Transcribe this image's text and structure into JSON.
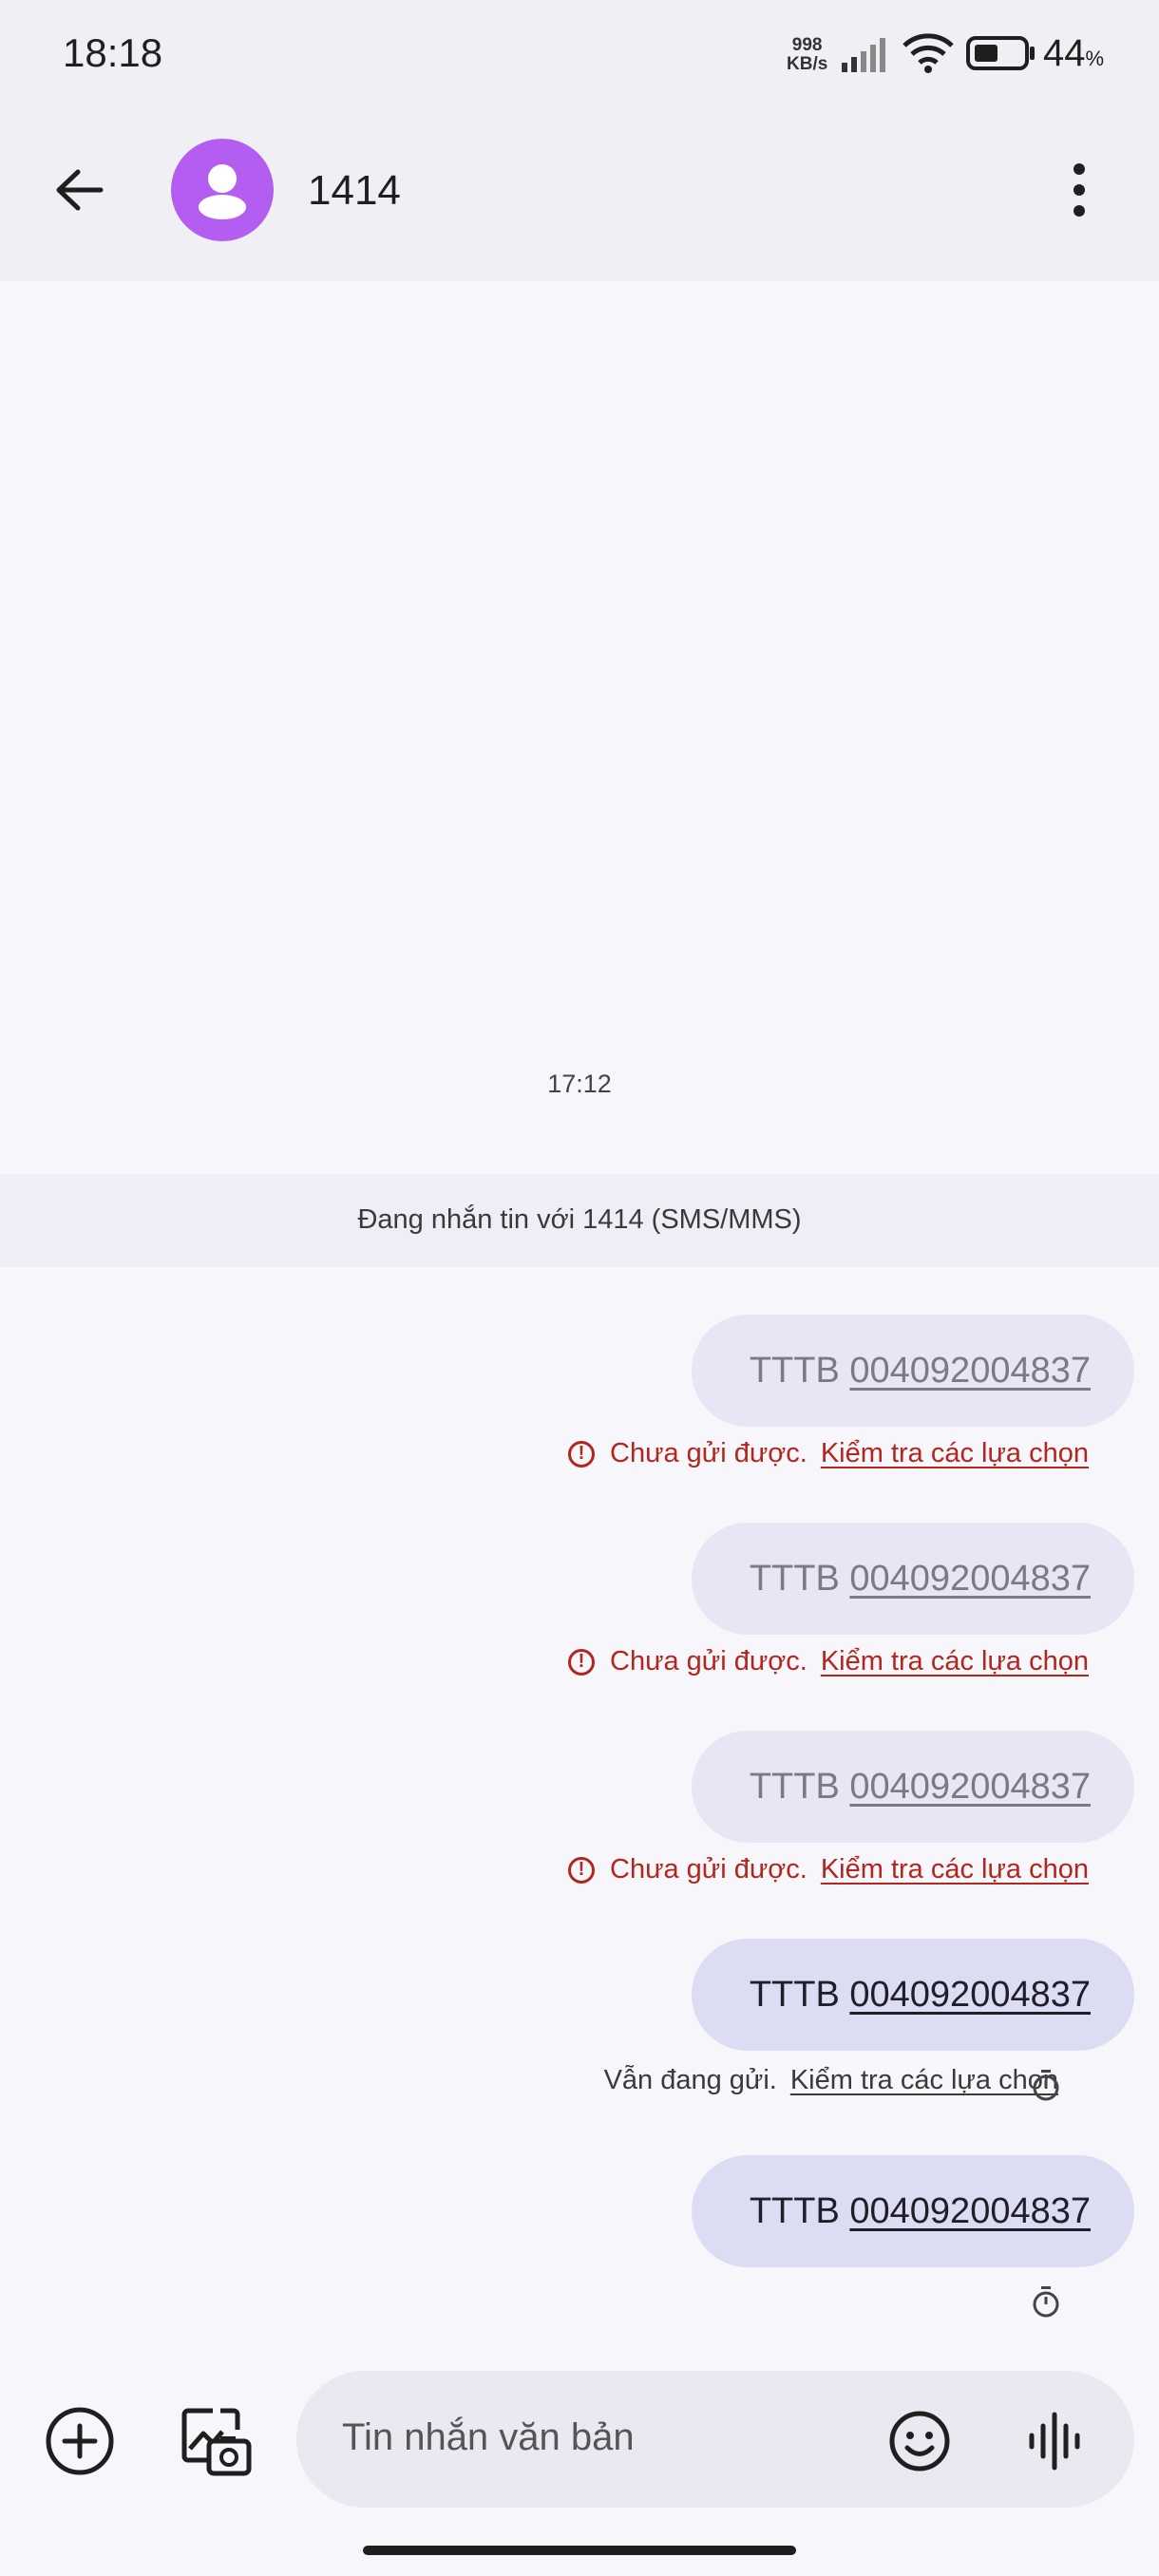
{
  "status_bar": {
    "time": "18:18",
    "net_speed_value": "998",
    "net_speed_unit": "KB/s",
    "battery_percent": "44",
    "battery_unit": "%",
    "icons": [
      "signal-icon",
      "wifi-icon",
      "battery-icon"
    ]
  },
  "header": {
    "title": "1414",
    "back_icon": "arrow-left-icon",
    "menu_icon": "more-vert-icon",
    "avatar_color": "#b35ef0"
  },
  "conversation": {
    "timestamp": "17:12",
    "banner": "Đang nhắn tin với 1414 (SMS/MMS)",
    "messages": [
      {
        "prefix": "TTTB",
        "number": "004092004837",
        "state": "failed",
        "status": "Chưa gửi được.",
        "action": "Kiểm tra các lựa chọn"
      },
      {
        "prefix": "TTTB",
        "number": "004092004837",
        "state": "failed",
        "status": "Chưa gửi được.",
        "action": "Kiểm tra các lựa chọn"
      },
      {
        "prefix": "TTTB",
        "number": "004092004837",
        "state": "failed",
        "status": "Chưa gửi được.",
        "action": "Kiểm tra các lựa chọn"
      },
      {
        "prefix": "TTTB",
        "number": "004092004837",
        "state": "pending",
        "status": "Vẫn đang gửi.",
        "action": "Kiểm tra các lựa chọn"
      },
      {
        "prefix": "TTTB",
        "number": "004092004837",
        "state": "pending",
        "status": "",
        "action": ""
      }
    ]
  },
  "composer": {
    "placeholder": "Tin nhắn văn bản",
    "icons": [
      "add-circle-icon",
      "gallery-camera-icon",
      "emoji-icon",
      "voice-waveform-icon"
    ]
  },
  "colors": {
    "error": "#b3261e",
    "accent_avatar": "#b35ef0"
  }
}
